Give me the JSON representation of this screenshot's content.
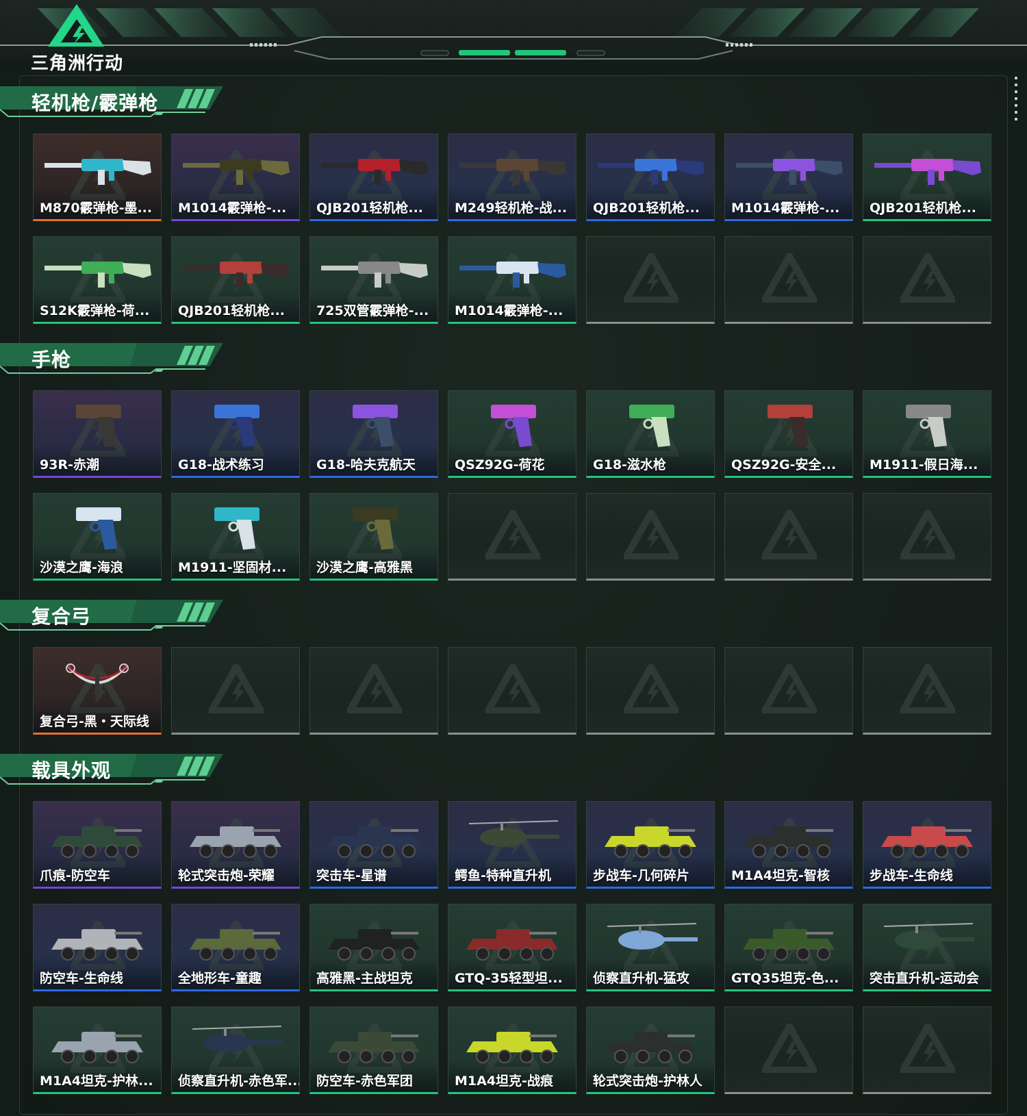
{
  "header": {
    "logo_text": "三角洲行动"
  },
  "colors": {
    "accent": "#23c57a",
    "rarity_purple": "#7a45d6",
    "rarity_blue": "#2d6ae0",
    "rarity_green": "#23c57a",
    "rarity_orange": "#e8702a",
    "empty_slot": "#8b908d"
  },
  "sections": [
    {
      "title": "轻机枪/霰弹枪",
      "kind": "gun",
      "slots": 14,
      "items": [
        {
          "label": "M870霰弹枪-墨...",
          "rarity": "orange"
        },
        {
          "label": "M1014霰弹枪-...",
          "rarity": "purple"
        },
        {
          "label": "QJB201轻机枪...",
          "rarity": "blue"
        },
        {
          "label": "M249轻机枪-战...",
          "rarity": "blue"
        },
        {
          "label": "QJB201轻机枪...",
          "rarity": "blue"
        },
        {
          "label": "M1014霰弹枪-...",
          "rarity": "blue"
        },
        {
          "label": "QJB201轻机枪...",
          "rarity": "green"
        },
        {
          "label": "S12K霰弹枪-荷...",
          "rarity": "green"
        },
        {
          "label": "QJB201轻机枪...",
          "rarity": "green"
        },
        {
          "label": "725双管霰弹枪-...",
          "rarity": "green"
        },
        {
          "label": "M1014霰弹枪-...",
          "rarity": "green"
        }
      ]
    },
    {
      "title": "手枪",
      "kind": "pistol",
      "slots": 14,
      "items": [
        {
          "label": "93R-赤潮",
          "rarity": "purple"
        },
        {
          "label": "G18-战术练习",
          "rarity": "blue"
        },
        {
          "label": "G18-哈夫克航天",
          "rarity": "blue"
        },
        {
          "label": "QSZ92G-荷花",
          "rarity": "green"
        },
        {
          "label": "G18-滋水枪",
          "rarity": "green"
        },
        {
          "label": "QSZ92G-安全...",
          "rarity": "green"
        },
        {
          "label": "M1911-假日海...",
          "rarity": "green"
        },
        {
          "label": "沙漠之鹰-海浪",
          "rarity": "green"
        },
        {
          "label": "M1911-坚固材...",
          "rarity": "green"
        },
        {
          "label": "沙漠之鹰-高雅黑",
          "rarity": "green"
        }
      ]
    },
    {
      "title": "复合弓",
      "kind": "bow",
      "slots": 7,
      "items": [
        {
          "label": "复合弓-黑・天际线",
          "rarity": "orange"
        }
      ]
    },
    {
      "title": "载具外观",
      "kind": "vehicle",
      "slots": 21,
      "items": [
        {
          "label": "爪痕-防空车",
          "rarity": "purple"
        },
        {
          "label": "轮式突击炮-荣耀",
          "rarity": "purple"
        },
        {
          "label": "突击车-星谱",
          "rarity": "blue"
        },
        {
          "label": "鳄鱼-特种直升机",
          "rarity": "blue"
        },
        {
          "label": "步战车-几何碎片",
          "rarity": "blue"
        },
        {
          "label": "M1A4坦克-智核",
          "rarity": "blue"
        },
        {
          "label": "步战车-生命线",
          "rarity": "blue"
        },
        {
          "label": "防空车-生命线",
          "rarity": "blue"
        },
        {
          "label": "全地形车-童趣",
          "rarity": "blue"
        },
        {
          "label": "高雅黑-主战坦克",
          "rarity": "green"
        },
        {
          "label": "GTQ-35轻型坦...",
          "rarity": "green"
        },
        {
          "label": "侦察直升机-猛攻",
          "rarity": "green"
        },
        {
          "label": "GTQ35坦克-色...",
          "rarity": "green"
        },
        {
          "label": "突击直升机-运动会",
          "rarity": "green"
        },
        {
          "label": "M1A4坦克-护林...",
          "rarity": "green"
        },
        {
          "label": "侦察直升机-赤色军...",
          "rarity": "green"
        },
        {
          "label": "防空车-赤色军团",
          "rarity": "green"
        },
        {
          "label": "M1A4坦克-战痕",
          "rarity": "green"
        },
        {
          "label": "轮式突击炮-护林人",
          "rarity": "green"
        }
      ]
    }
  ]
}
